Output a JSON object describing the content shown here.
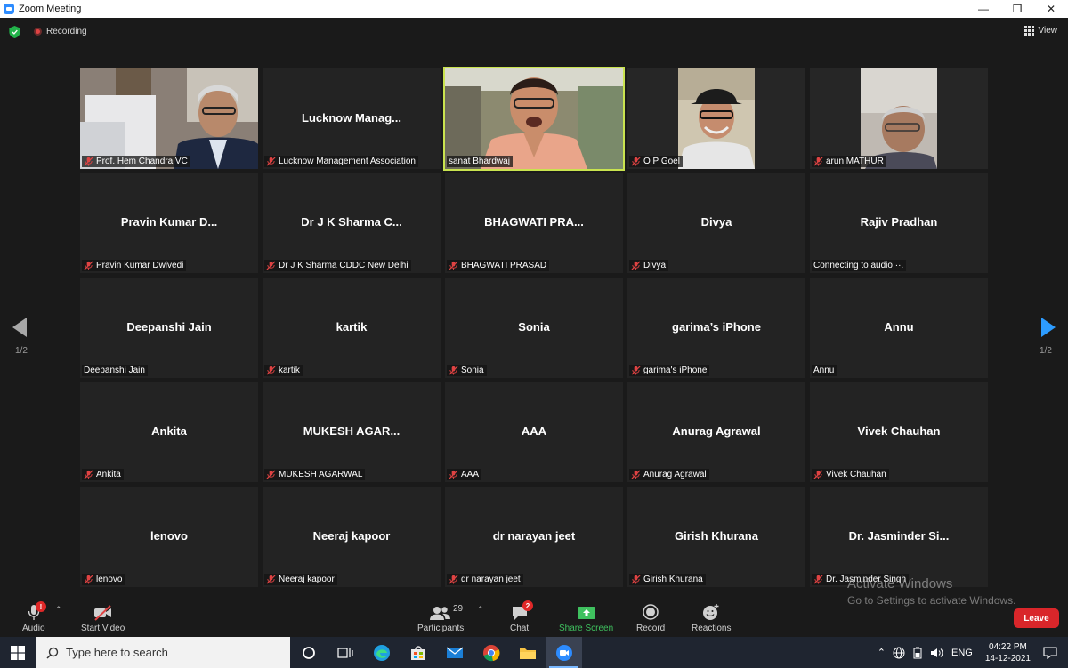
{
  "window": {
    "title": "Zoom Meeting"
  },
  "topbar": {
    "recording_label": "Recording",
    "view_label": "View"
  },
  "tiles": [
    {
      "label": "Prof. Hem Chandra VC",
      "big": "",
      "muted": true,
      "video": true
    },
    {
      "label": "Lucknow Management Association",
      "big": "Lucknow  Manag...",
      "muted": true,
      "video": false
    },
    {
      "label": "sanat Bhardwaj",
      "big": "",
      "muted": false,
      "video": true,
      "active": true
    },
    {
      "label": "O P Goel",
      "big": "",
      "muted": true,
      "video": true
    },
    {
      "label": "arun MATHUR",
      "big": "",
      "muted": true,
      "video": true
    },
    {
      "label": "Pravin Kumar Dwivedi",
      "big": "Pravin  Kumar  D...",
      "muted": true
    },
    {
      "label": "Dr J K Sharma CDDC New Delhi",
      "big": "Dr J K Sharma C...",
      "muted": true
    },
    {
      "label": "BHAGWATI PRASAD",
      "big": "BHAGWATI  PRA...",
      "muted": true
    },
    {
      "label": "Divya",
      "big": "Divya",
      "muted": true
    },
    {
      "label": "Connecting to audio ··.",
      "big": "Rajiv Pradhan",
      "muted": false
    },
    {
      "label": "Deepanshi Jain",
      "big": "Deepanshi Jain",
      "muted": false
    },
    {
      "label": "kartik",
      "big": "kartik",
      "muted": true
    },
    {
      "label": "Sonia",
      "big": "Sonia",
      "muted": true
    },
    {
      "label": "garima's iPhone",
      "big": "garima’s iPhone",
      "muted": true
    },
    {
      "label": "Annu",
      "big": "Annu",
      "muted": false
    },
    {
      "label": "Ankita",
      "big": "Ankita",
      "muted": true
    },
    {
      "label": "MUKESH AGARWAL",
      "big": "MUKESH  AGAR...",
      "muted": true
    },
    {
      "label": "AAA",
      "big": "AAA",
      "muted": true
    },
    {
      "label": "Anurag Agrawal",
      "big": "Anurag Agrawal",
      "muted": true
    },
    {
      "label": "Vivek Chauhan",
      "big": "Vivek Chauhan",
      "muted": true
    },
    {
      "label": "lenovo",
      "big": "lenovo",
      "muted": true
    },
    {
      "label": "Neeraj kapoor",
      "big": "Neeraj kapoor",
      "muted": true
    },
    {
      "label": "dr narayan jeet",
      "big": "dr narayan jeet",
      "muted": true
    },
    {
      "label": "Girish Khurana",
      "big": "Girish Khurana",
      "muted": true
    },
    {
      "label": "Dr. Jasminder Singh",
      "big": "Dr. Jasminder Si...",
      "muted": true
    }
  ],
  "pager": {
    "left": "1/2",
    "right": "1/2"
  },
  "watermark": {
    "line1": "Activate Windows",
    "line2": "Go to Settings to activate Windows."
  },
  "toolbar": {
    "audio": "Audio",
    "audio_badge": "!",
    "video": "Start Video",
    "participants": "Participants",
    "participants_count": "29",
    "chat": "Chat",
    "chat_badge": "2",
    "share": "Share Screen",
    "record": "Record",
    "reactions": "Reactions",
    "leave": "Leave"
  },
  "taskbar": {
    "search_placeholder": "Type here to search",
    "lang": "ENG",
    "time": "04:22 PM",
    "date": "14-12-2021"
  },
  "colors": {
    "active_speaker": "#c9e34f",
    "mute_red": "#e04343",
    "share_green": "#3fc15f",
    "leave_red": "#d9262a"
  }
}
